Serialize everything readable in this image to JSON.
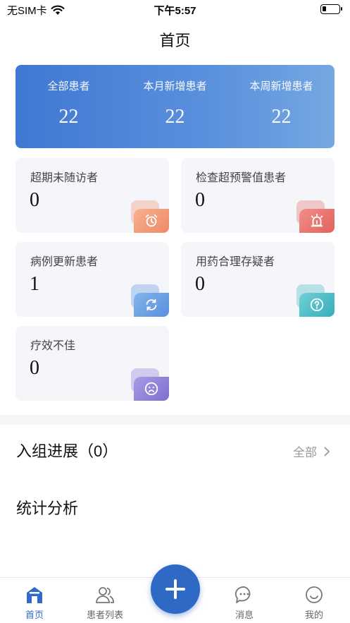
{
  "status_bar": {
    "carrier": "无SIM卡",
    "time": "下午5:57"
  },
  "nav": {
    "title": "首页"
  },
  "summary": [
    {
      "label": "全部患者",
      "value": "22"
    },
    {
      "label": "本月新增患者",
      "value": "22"
    },
    {
      "label": "本周新增患者",
      "value": "22"
    }
  ],
  "stats": [
    {
      "label": "超期未随访者",
      "value": "0",
      "icon": "alarm-clock-icon",
      "color": "#f08f6e"
    },
    {
      "label": "检查超预警值患者",
      "value": "0",
      "icon": "alert-beacon-icon",
      "color": "#e9706a"
    },
    {
      "label": "病例更新患者",
      "value": "1",
      "icon": "refresh-icon",
      "color": "#5b95df"
    },
    {
      "label": "用药合理存疑者",
      "value": "0",
      "icon": "question-icon",
      "color": "#43b9c4"
    },
    {
      "label": "疗效不佳",
      "value": "0",
      "icon": "sad-face-icon",
      "color": "#8c7fd6"
    }
  ],
  "enrollment": {
    "title": "入组进展（0）",
    "all_label": "全部"
  },
  "analysis": {
    "title": "统计分析"
  },
  "tab_bar": {
    "home": "首页",
    "patients": "患者列表",
    "messages": "消息",
    "mine": "我的"
  },
  "colors": {
    "accent": "#2f69c6",
    "card_bg": "#f4f6fa"
  }
}
